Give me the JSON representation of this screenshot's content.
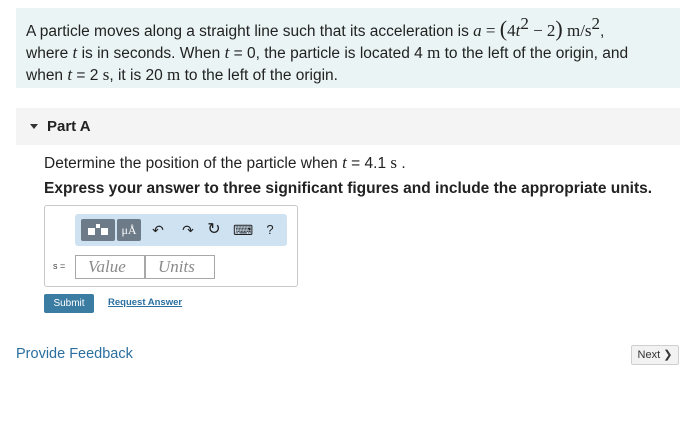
{
  "problem": {
    "line1_prefix": "A particle moves along a straight line such that its acceleration is ",
    "accel_var": "a",
    "equals": " = ",
    "paren_open": "(",
    "t_coeff": "4",
    "t_var": "t",
    "t_exp": "2",
    "minus": " − 2",
    "paren_close": ")",
    "accel_unit": " m/s",
    "accel_unit_exp": "2",
    "line1_suffix": ",",
    "line2_prefix": "where ",
    "line2_t": "t",
    "line2_mid": " is in seconds. When ",
    "line2_t2": "t",
    "line2_eq": " = 0, the particle is located 4 ",
    "line2_unit": "m",
    "line2_suffix": " to the left of the origin, and",
    "line3_prefix": "when ",
    "line3_t": "t",
    "line3_eq": " = 2 ",
    "line3_unit": "s",
    "line3_mid": ", it is 20 ",
    "line3_unit2": "m",
    "line3_suffix": " to the left of the origin."
  },
  "part": {
    "title": "Part A"
  },
  "question": {
    "prefix": "Determine the position of the particle when ",
    "t_var": "t",
    "eq": " = 4.1 ",
    "unit": "s",
    "suffix": " ."
  },
  "instruction": "Express your answer to three significant figures and include the appropriate units.",
  "answer": {
    "variable": "s =",
    "value_placeholder": "Value",
    "units_placeholder": "Units",
    "toolbar": {
      "units_label": "μÅ",
      "undo_icon": "↶",
      "redo_icon": "↷",
      "reset_icon": "↻",
      "keyboard_icon": "⌨",
      "help_label": "?"
    }
  },
  "buttons": {
    "submit": "Submit",
    "request_answer": "Request Answer",
    "provide_feedback": "Provide Feedback",
    "next": "Next ❯"
  },
  "colors": {
    "problem_bg": "#eaf4f4",
    "submit_bg": "#3b7ca2",
    "link": "#2a6fa0",
    "toolbar_bg": "#cfe2f2"
  }
}
